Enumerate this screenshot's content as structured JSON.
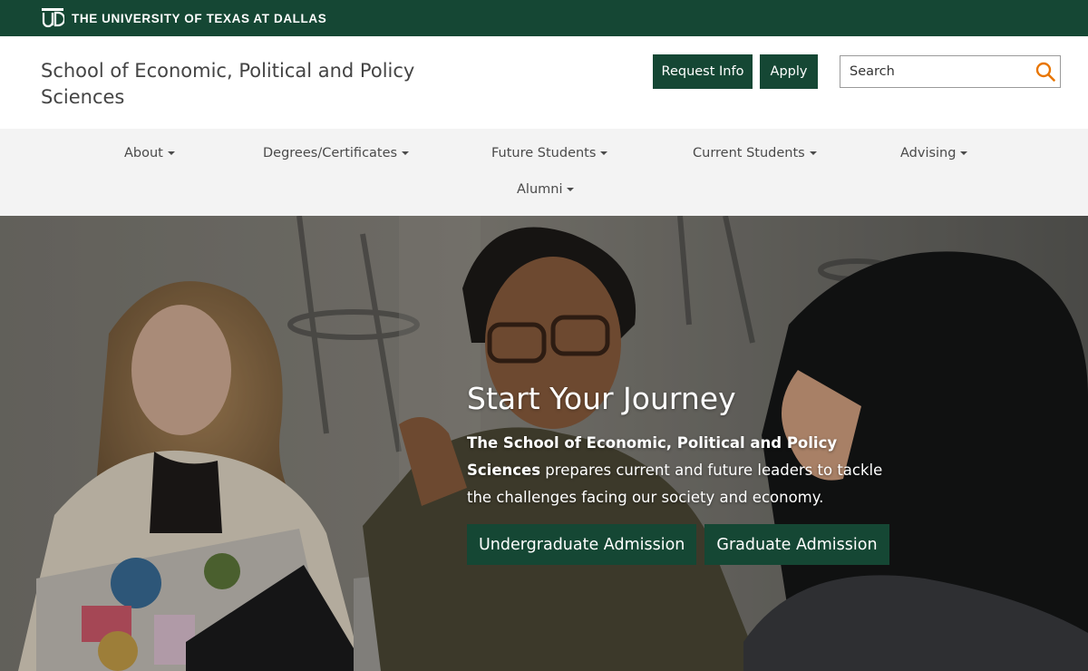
{
  "topbar": {
    "university_name": "THE UNIVERSITY OF TEXAS AT DALLAS",
    "logo_icon": "utd-monogram-icon"
  },
  "header": {
    "school_title": "School of Economic, Political and Policy Sciences",
    "request_info_label": "Request Info",
    "apply_label": "Apply",
    "search_placeholder": "Search",
    "search_icon": "search-icon"
  },
  "nav": {
    "items": [
      {
        "label": "About"
      },
      {
        "label": "Degrees/Certificates"
      },
      {
        "label": "Future Students"
      },
      {
        "label": "Current Students"
      },
      {
        "label": "Advising"
      },
      {
        "label": "Alumni"
      }
    ]
  },
  "hero": {
    "title": "Start Your Journey",
    "text_bold": "The School of Economic, Political and Policy Sciences",
    "text_rest": " prepares current and future leaders to tackle the challenges facing our society and economy.",
    "undergrad_label": "Undergraduate Admission",
    "grad_label": "Graduate Admission"
  },
  "colors": {
    "brand_green": "#154734",
    "search_accent": "#e87500",
    "nav_bg": "#f3f3f3"
  }
}
